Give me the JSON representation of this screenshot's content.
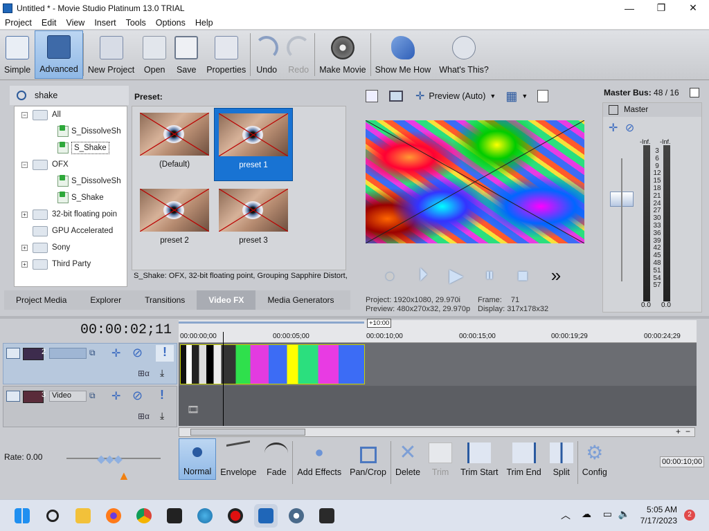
{
  "window": {
    "title": "Untitled * - Movie Studio Platinum 13.0 TRIAL",
    "minimize": "—",
    "maximize": "❐",
    "close": "✕"
  },
  "menu": [
    "Project",
    "Edit",
    "View",
    "Insert",
    "Tools",
    "Options",
    "Help"
  ],
  "toolbar": [
    {
      "label": "Simple",
      "icon": "simple-layout-icon"
    },
    {
      "label": "Advanced",
      "icon": "advanced-layout-icon",
      "selected": true
    },
    {
      "label": "New Project",
      "icon": "new-project-icon"
    },
    {
      "label": "Open",
      "icon": "folder-open-icon"
    },
    {
      "label": "Save",
      "icon": "floppy-disk-icon"
    },
    {
      "label": "Properties",
      "icon": "properties-icon"
    },
    {
      "label": "Undo",
      "icon": "undo-icon"
    },
    {
      "label": "Redo",
      "icon": "redo-icon",
      "disabled": true
    },
    {
      "label": "Make Movie",
      "icon": "film-reel-icon"
    },
    {
      "label": "Show Me How",
      "icon": "pointer-hand-icon"
    },
    {
      "label": "What's This?",
      "icon": "help-cursor-icon"
    }
  ],
  "search": {
    "value": "shake"
  },
  "tree": [
    {
      "label": "All",
      "level": 0,
      "expander": "−",
      "type": "folder"
    },
    {
      "label": "S_DissolveSh",
      "level": 1,
      "type": "fx"
    },
    {
      "label": "S_Shake",
      "level": 1,
      "type": "fx",
      "selected": true
    },
    {
      "label": "OFX",
      "level": 0,
      "expander": "−",
      "type": "folder"
    },
    {
      "label": "S_DissolveSh",
      "level": 1,
      "type": "fx"
    },
    {
      "label": "S_Shake",
      "level": 1,
      "type": "fx"
    },
    {
      "label": "32-bit floating poin",
      "level": 0,
      "expander": "+",
      "type": "folder"
    },
    {
      "label": "GPU Accelerated",
      "level": 0,
      "expander": "",
      "type": "folder"
    },
    {
      "label": "Sony",
      "level": 0,
      "expander": "+",
      "type": "folder"
    },
    {
      "label": "Third Party",
      "level": 0,
      "expander": "+",
      "type": "folder"
    }
  ],
  "presets": {
    "heading": "Preset:",
    "items": [
      {
        "label": "(Default)"
      },
      {
        "label": "preset 1",
        "selected": true
      },
      {
        "label": "preset 2"
      },
      {
        "label": "preset 3"
      }
    ],
    "description": "S_Shake: OFX, 32-bit floating point, Grouping  Sapphire Distort,"
  },
  "tabs": [
    {
      "label": "Project Media"
    },
    {
      "label": "Explorer"
    },
    {
      "label": "Transitions"
    },
    {
      "label": "Video FX",
      "active": true
    },
    {
      "label": "Media Generators"
    }
  ],
  "preview": {
    "mode": "Preview (Auto)",
    "project_label": "Project:",
    "project_value": "1920x1080, 29.970i",
    "preview_label": "Preview:",
    "preview_value": "480x270x32, 29.970p",
    "frame_label": "Frame:",
    "frame_value": "71",
    "display_label": "Display:",
    "display_value": "317x178x32"
  },
  "master": {
    "title": "Master Bus:",
    "count": "48 / 16",
    "label": "Master",
    "inf_left": "-Inf.",
    "inf_right": "-Inf.",
    "scale": [
      "3",
      "6",
      "9",
      "12",
      "15",
      "18",
      "21",
      "24",
      "27",
      "30",
      "33",
      "36",
      "39",
      "42",
      "45",
      "48",
      "51",
      "54",
      "57"
    ],
    "bottom_left": "0.0",
    "bottom_right": "0.0"
  },
  "timeline": {
    "timecode": "00:00:02;11",
    "marker": "+10:00",
    "ticks": [
      "00:00:00;00",
      "00:00:05;00",
      "00:00:10;00",
      "00:00:15;00",
      "00:00:19;29",
      "00:00:24;29"
    ],
    "tracks": [
      {
        "number": "2",
        "name": ""
      },
      {
        "number": "3",
        "name": "Video"
      }
    ]
  },
  "rate": "Rate: 0.00",
  "edit_toolbar": [
    {
      "label": "Normal",
      "icon": "normal-edit-icon",
      "selected": true
    },
    {
      "label": "Envelope",
      "icon": "envelope-icon"
    },
    {
      "label": "Fade",
      "icon": "fade-icon"
    },
    {
      "label": "Add Effects",
      "icon": "add-effects-icon"
    },
    {
      "label": "Pan/Crop",
      "icon": "crop-icon"
    },
    {
      "label": "Delete",
      "icon": "delete-icon"
    },
    {
      "label": "Trim",
      "icon": "trim-icon",
      "disabled": true
    },
    {
      "label": "Trim Start",
      "icon": "trim-start-icon"
    },
    {
      "label": "Trim End",
      "icon": "trim-end-icon"
    },
    {
      "label": "Split",
      "icon": "split-icon"
    },
    {
      "label": "Config",
      "icon": "gear-icon"
    }
  ],
  "end_timecode": "00:00:10;00",
  "taskbar": {
    "time": "5:05 AM",
    "date": "7/17/2023",
    "notifications": "2"
  }
}
